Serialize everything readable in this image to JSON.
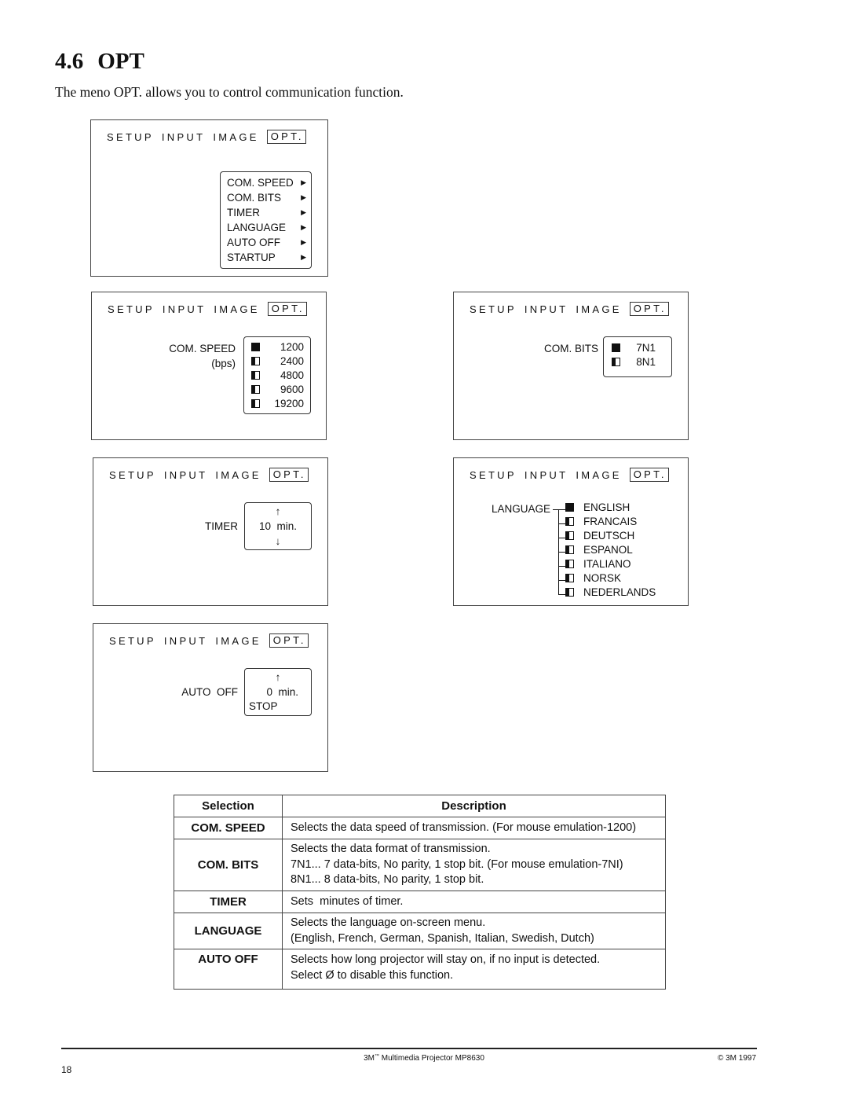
{
  "section": {
    "number": "4.6",
    "title": "OPT",
    "intro": "The meno OPT. allows you to control communication function."
  },
  "osd_tabs": {
    "setup": "SETUP",
    "input": "INPUT",
    "image": "IMAGE",
    "opt": "OPT."
  },
  "screens": {
    "main_menu": {
      "items": [
        {
          "label": "COM. SPEED",
          "icon": "triangle-right-icon"
        },
        {
          "label": "COM. BITS",
          "icon": "triangle-right-icon"
        },
        {
          "label": "TIMER",
          "icon": "triangle-right-icon"
        },
        {
          "label": "LANGUAGE",
          "icon": "triangle-right-icon"
        },
        {
          "label": "AUTO OFF",
          "icon": "triangle-right-icon"
        },
        {
          "label": "STARTUP",
          "icon": "triangle-right-icon"
        }
      ],
      "arrow_glyph": "▶"
    },
    "com_speed": {
      "label": "COM. SPEED",
      "unit": "(bps)",
      "options": [
        {
          "value": "1200",
          "selected": true
        },
        {
          "value": "2400",
          "selected": false
        },
        {
          "value": "4800",
          "selected": false
        },
        {
          "value": "9600",
          "selected": false
        },
        {
          "value": "19200",
          "selected": false
        }
      ]
    },
    "com_bits": {
      "label": "COM. BITS",
      "options": [
        {
          "value": "7N1",
          "selected": true
        },
        {
          "value": "8N1",
          "selected": false
        }
      ]
    },
    "timer": {
      "label": "TIMER",
      "up_glyph": "↑",
      "value": "10  min.",
      "down_glyph": "↓"
    },
    "language": {
      "label": "LANGUAGE",
      "options": [
        {
          "value": "ENGLISH",
          "selected": true
        },
        {
          "value": "FRANCAIS",
          "selected": false
        },
        {
          "value": "DEUTSCH",
          "selected": false
        },
        {
          "value": "ESPANOL",
          "selected": false
        },
        {
          "value": "ITALIANO",
          "selected": false
        },
        {
          "value": "NORSK",
          "selected": false
        },
        {
          "value": "NEDERLANDS",
          "selected": false
        }
      ]
    },
    "auto_off": {
      "label": "AUTO  OFF",
      "up_glyph": "↑",
      "value": "0  min.",
      "stop": "STOP"
    }
  },
  "table": {
    "headers": {
      "selection": "Selection",
      "description": "Description"
    },
    "rows": [
      {
        "selection": "COM. SPEED",
        "lines": [
          "Selects the data speed of transmission. (For mouse emulation-1200)"
        ]
      },
      {
        "selection": "COM. BITS",
        "lines": [
          "Selects the data format of transmission.",
          "7N1... 7 data-bits, No parity, 1 stop bit. (For mouse emulation-7NI)",
          "8N1... 8 data-bits, No parity, 1 stop bit."
        ]
      },
      {
        "selection": "TIMER",
        "lines": [
          "Sets  minutes of timer."
        ]
      },
      {
        "selection": "LANGUAGE",
        "lines": [
          "Selects the language on-screen menu.",
          "(English, French, German, Spanish, Italian, Swedish, Dutch)"
        ]
      },
      {
        "selection": "AUTO OFF",
        "lines": [
          "Selects how long projector will stay on, if no input is detected.",
          "Select Ø to disable this function."
        ]
      }
    ]
  },
  "footer": {
    "product_prefix": "3M",
    "trademark": "™",
    "product_suffix": " Multimedia Projector MP8630",
    "copyright": "© 3M 1997",
    "page_number": "18"
  }
}
